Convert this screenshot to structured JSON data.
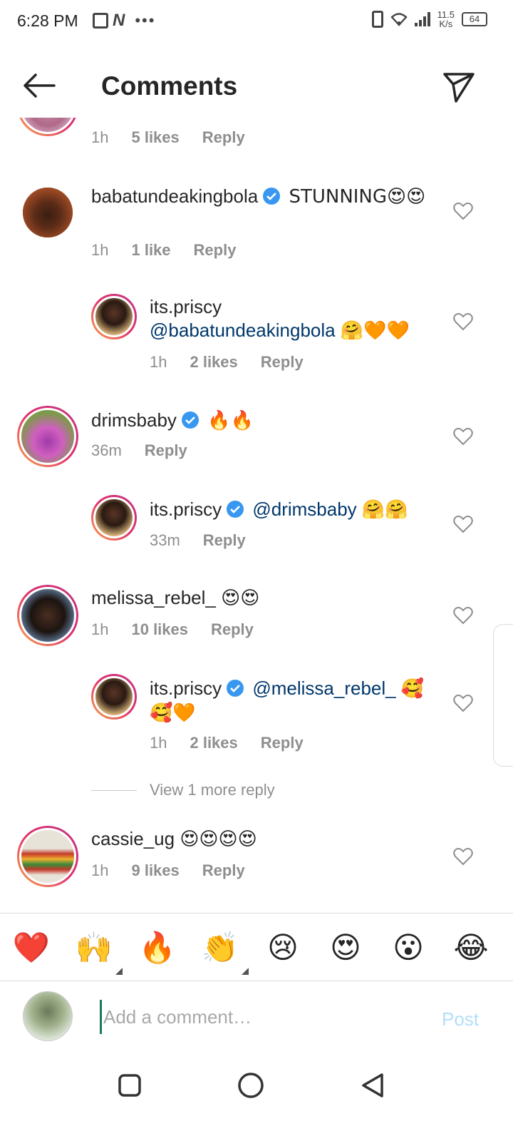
{
  "status_bar": {
    "time": "6:28 PM",
    "speed_value": "11.5",
    "speed_unit": "K/s",
    "battery": "64"
  },
  "header": {
    "title": "Comments"
  },
  "top_partial": {
    "time": "1h",
    "likes": "5 likes",
    "reply": "Reply"
  },
  "comments": [
    {
      "user": "babatundeakingbola",
      "verified": true,
      "text": "STUNNING😍😍",
      "time": "1h",
      "likes": "1 like",
      "reply": "Reply"
    },
    {
      "user": "its.priscy",
      "verified": false,
      "mention": "@babatundeakingbola",
      "text": "🤗🧡🧡",
      "time": "1h",
      "likes": "2 likes",
      "reply": "Reply"
    },
    {
      "user": "drimsbaby",
      "verified": true,
      "text": "🔥🔥",
      "time": "36m",
      "reply": "Reply"
    },
    {
      "user": "its.priscy",
      "verified": true,
      "mention": "@drimsbaby",
      "text": "🤗🤗",
      "time": "33m",
      "reply": "Reply"
    },
    {
      "user": "melissa_rebel_",
      "verified": false,
      "text": "😍😍",
      "time": "1h",
      "likes": "10 likes",
      "reply": "Reply"
    },
    {
      "user": "its.priscy",
      "verified": true,
      "mention": "@melissa_rebel_",
      "text": "🥰🥰🧡",
      "time": "1h",
      "likes": "2 likes",
      "reply": "Reply"
    },
    {
      "user": "cassie_ug",
      "verified": false,
      "text": "😍😍😍😍",
      "time": "1h",
      "likes": "9 likes",
      "reply": "Reply"
    }
  ],
  "view_more": "View 1 more reply",
  "quick_emojis": [
    "❤️",
    "🙌",
    "🔥",
    "👏",
    "😢",
    "😍",
    "😮",
    "😂"
  ],
  "composer": {
    "placeholder": "Add a comment…",
    "post_label": "Post"
  },
  "colors": {
    "mention": "#00376b",
    "post_disabled": "#b2dffc",
    "verified": "#3897f0"
  }
}
